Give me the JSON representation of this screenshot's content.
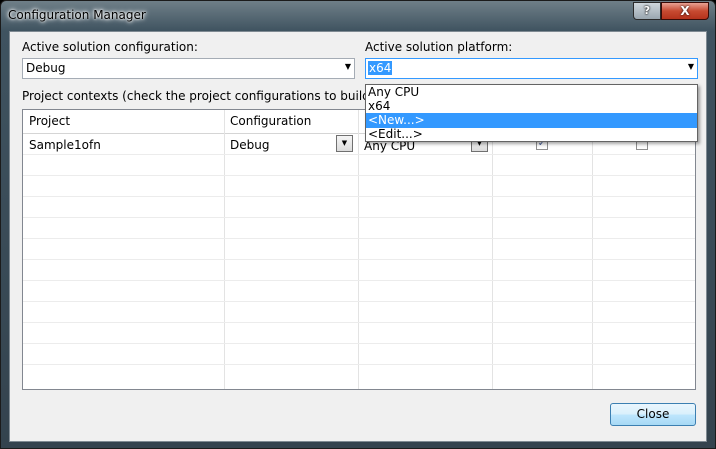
{
  "window": {
    "title": "Configuration Manager",
    "help_label": "?",
    "close_label": "X"
  },
  "config": {
    "label": "Active solution configuration:",
    "value": "Debug"
  },
  "platform": {
    "label": "Active solution platform:",
    "value": "x64",
    "options": [
      "Any CPU",
      "x64",
      "<New...>",
      "<Edit...>"
    ],
    "selected_option": "<New...>"
  },
  "contexts": {
    "label": "Project contexts (check the project configurations to build or dep"
  },
  "grid": {
    "headers": [
      "Project",
      "Configuration"
    ],
    "rows": [
      {
        "project": "Sample1ofn",
        "configuration": "Debug",
        "platform": "Any CPU",
        "build": true,
        "deploy": false
      }
    ]
  },
  "buttons": {
    "close": "Close"
  },
  "colors": {
    "accent": "#3399ff"
  }
}
